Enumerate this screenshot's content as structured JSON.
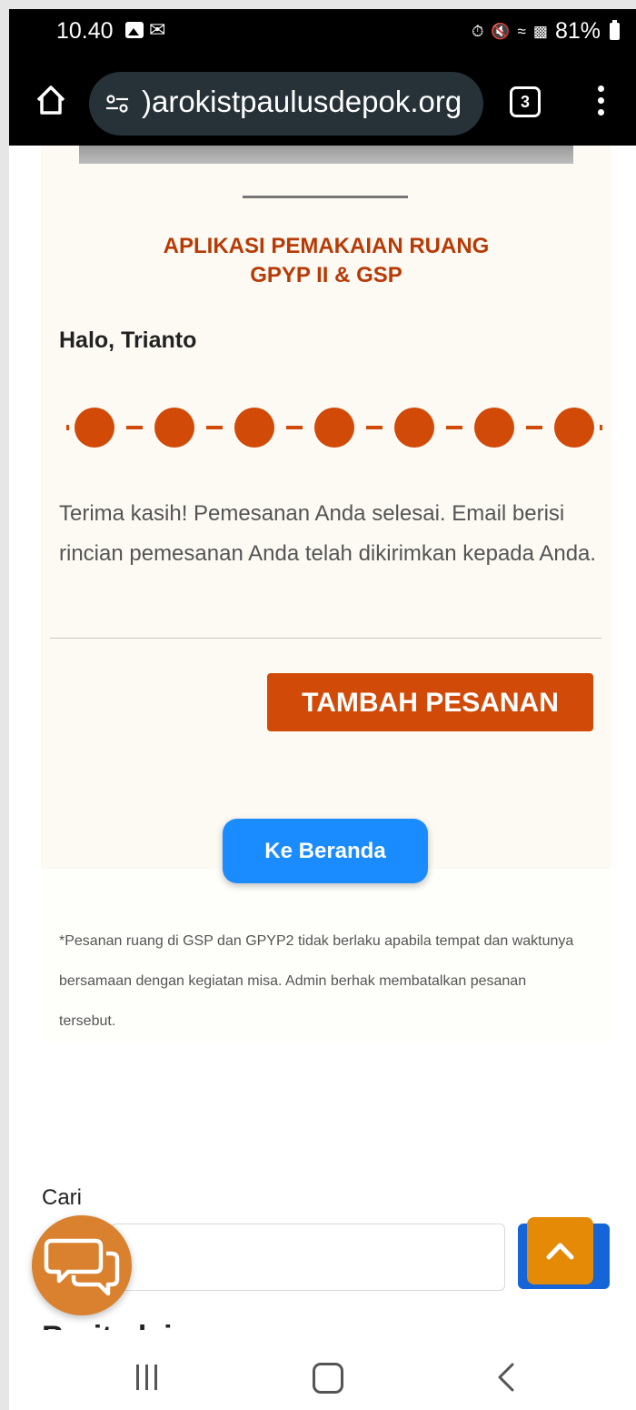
{
  "status_bar": {
    "time": "10.40",
    "battery": "81%"
  },
  "browser": {
    "url": ")arokistpaulusdepok.org",
    "tab_count": "3"
  },
  "page": {
    "app_title_line1": "APLIKASI PEMAKAIAN RUANG",
    "app_title_line2": "GPYP II & GSP",
    "greeting": "Halo, Trianto",
    "stepper": {
      "total_steps": 7,
      "completed_steps": 7,
      "color": "#d14a07"
    },
    "thanks_message": "Terima kasih! Pemesanan Anda selesai. Email berisi rincian pemesanan Anda telah dikirimkan kepada Anda.",
    "add_order_label": "TAMBAH PESANAN",
    "home_button_label": "Ke Beranda",
    "note": "*Pesanan ruang di GSP dan GPYP2 tidak berlaku apabila tempat dan waktunya bersamaan dengan kegiatan misa. Admin berhak membatalkan pesanan tersebut.",
    "search_label": "Cari",
    "search_value": "",
    "partial_heading": "Berita lainnya"
  },
  "colors": {
    "accent": "#d14a07",
    "primary_blue": "#1a8cff",
    "chat_fab": "#d9812e",
    "back_to_top": "#e58a06"
  },
  "icons": {
    "home": "home-icon",
    "site_settings": "tune-icon",
    "menu": "more-vert-icon",
    "chat": "chat-bubbles-icon",
    "back_to_top": "chevron-up-icon"
  }
}
